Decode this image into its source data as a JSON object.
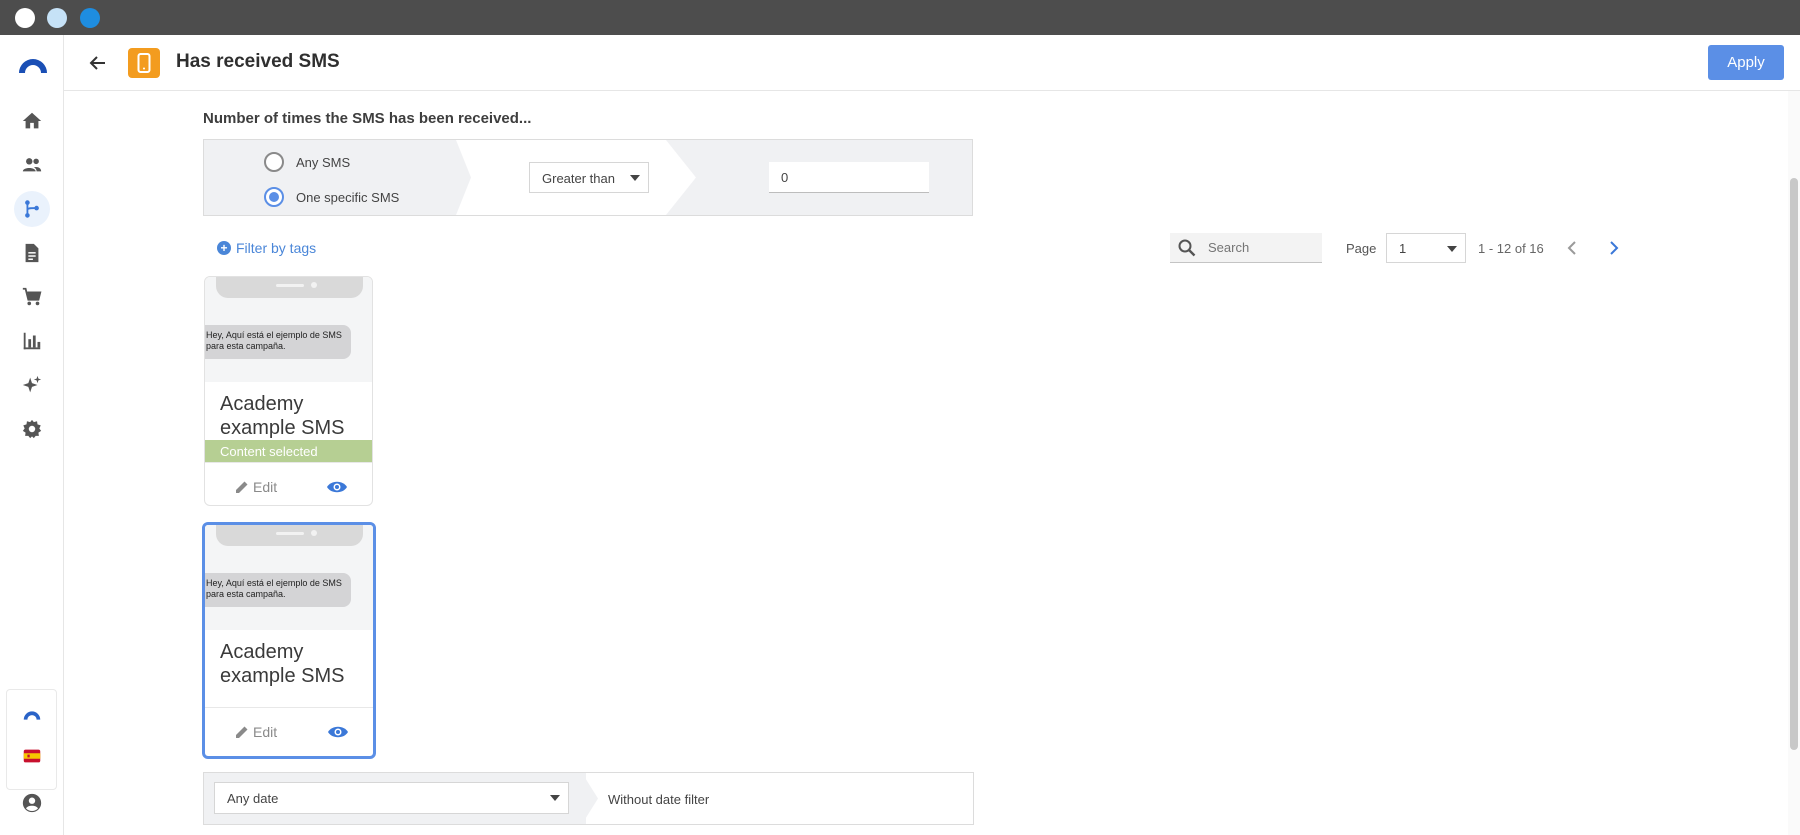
{
  "header": {
    "title": "Has received SMS",
    "apply_label": "Apply"
  },
  "nav": {
    "items": [
      "home-icon",
      "contacts-icon",
      "automation-icon",
      "content-icon",
      "ecommerce-icon",
      "reports-icon",
      "ai-icon",
      "settings-icon"
    ],
    "active": "automation-icon"
  },
  "section": {
    "label": "Number of times the SMS has been received..."
  },
  "sms_choice": {
    "option_any": "Any SMS",
    "option_specific": "One specific SMS",
    "selected": "One specific SMS"
  },
  "comparator": {
    "selected": "Greater than"
  },
  "count_input": {
    "value": "0"
  },
  "filter_tags_label": "Filter by tags",
  "search": {
    "placeholder": "Search"
  },
  "pagination": {
    "page_label": "Page",
    "current_page": "1",
    "range": "1 - 12 of 16"
  },
  "cards": [
    {
      "bubble_line1": "Hey, Aquí está el ejemplo de SMS",
      "bubble_line2": "para esta campaña.",
      "title": "Academy example SMS",
      "status": "Content selected",
      "edit_label": "Edit"
    },
    {
      "bubble_line1": "Hey, Aquí está el ejemplo de SMS",
      "bubble_line2": "para esta campaña.",
      "title": "Academy example SMS",
      "edit_label": "Edit"
    }
  ],
  "date_filter": {
    "selected": "Any date",
    "description": "Without date filter"
  },
  "colors": {
    "accent": "#5b8fe6",
    "sms_badge": "#f39c1f",
    "selected_bar": "#b6cf93"
  }
}
